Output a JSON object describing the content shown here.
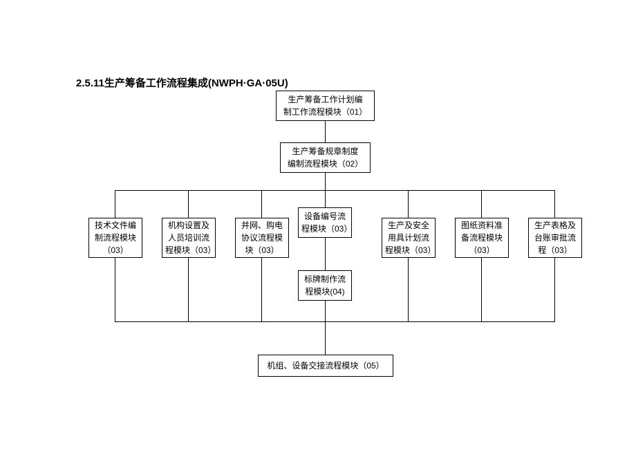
{
  "title": "2.5.11生产筹备工作流程集成(NWPH·GA·05U)",
  "boxes": {
    "b01_l1": "生产筹备工作计划编",
    "b01_l2": "制工作流程模块（01）",
    "b02_l1": "生产筹备规章制度",
    "b02_l2": "编制流程模块（02）",
    "b03a_l1": "技术文件编",
    "b03a_l2": "制流程模块",
    "b03a_l3": "（03）",
    "b03b_l1": "机构设置及",
    "b03b_l2": "人员培训流",
    "b03b_l3": "程模块（03）",
    "b03c_l1": "并网、购电",
    "b03c_l2": "协议流程模",
    "b03c_l3": "块（03）",
    "b03d_l1": "设备编号流",
    "b03d_l2": "程模块（03）",
    "b03e_l1": "生产及安全",
    "b03e_l2": "用具计划流",
    "b03e_l3": "程模块（03）",
    "b03f_l1": "图纸资料准",
    "b03f_l2": "备流程模块",
    "b03f_l3": "（03）",
    "b03g_l1": "生产表格及",
    "b03g_l2": "台账审批流",
    "b03g_l3": "程（03）",
    "b04_l1": "标牌制作流",
    "b04_l2": "程模块(04)",
    "b05_l1": "机组、设备交接流程模块（05）"
  }
}
